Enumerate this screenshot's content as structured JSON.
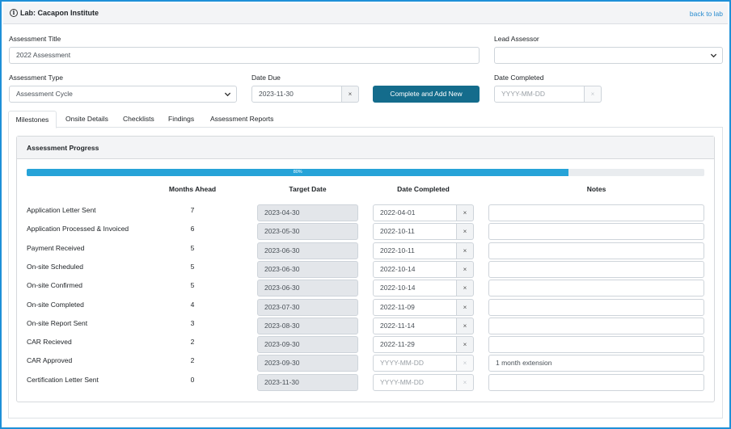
{
  "header": {
    "title": "Lab: Cacapon Institute",
    "back_link": "back to lab",
    "info_icon": "i"
  },
  "form": {
    "assessment_title_label": "Assessment Title",
    "assessment_title_value": "2022 Assessment",
    "lead_assessor_label": "Lead Assessor",
    "lead_assessor_value": "",
    "assessment_type_label": "Assessment Type",
    "assessment_type_value": "Assessment Cycle",
    "date_due_label": "Date Due",
    "date_due_value": "2023-11-30",
    "complete_button": "Complete and Add New",
    "date_completed_label": "Date Completed",
    "date_completed_placeholder": "YYYY-MM-DD",
    "clear_symbol": "×"
  },
  "tabs": [
    "Milestones",
    "Onsite Details",
    "Checklists",
    "Findings",
    "Assessment Reports"
  ],
  "active_tab": "Milestones",
  "progress": {
    "title": "Assessment Progress",
    "percent": 80,
    "label": "80%"
  },
  "table": {
    "headers": {
      "months": "Months Ahead",
      "target": "Target Date",
      "completed": "Date Completed",
      "notes": "Notes"
    },
    "rows": [
      {
        "label": "Application Letter Sent",
        "months": "7",
        "target": "2023-04-30",
        "completed": "2022-04-01",
        "notes": ""
      },
      {
        "label": "Application Processed & Invoiced",
        "months": "6",
        "target": "2023-05-30",
        "completed": "2022-10-11",
        "notes": ""
      },
      {
        "label": "Payment Received",
        "months": "5",
        "target": "2023-06-30",
        "completed": "2022-10-11",
        "notes": ""
      },
      {
        "label": "On-site Scheduled",
        "months": "5",
        "target": "2023-06-30",
        "completed": "2022-10-14",
        "notes": ""
      },
      {
        "label": "On-site Confirmed",
        "months": "5",
        "target": "2023-06-30",
        "completed": "2022-10-14",
        "notes": ""
      },
      {
        "label": "On-site Completed",
        "months": "4",
        "target": "2023-07-30",
        "completed": "2022-11-09",
        "notes": ""
      },
      {
        "label": "On-site Report Sent",
        "months": "3",
        "target": "2023-08-30",
        "completed": "2022-11-14",
        "notes": ""
      },
      {
        "label": "CAR Recieved",
        "months": "2",
        "target": "2023-09-30",
        "completed": "2022-11-29",
        "notes": ""
      },
      {
        "label": "CAR Approved",
        "months": "2",
        "target": "2023-09-30",
        "completed": "",
        "notes": "1 month extension"
      },
      {
        "label": "Certification Letter Sent",
        "months": "0",
        "target": "2023-11-30",
        "completed": "",
        "notes": ""
      }
    ],
    "completed_placeholder": "YYYY-MM-DD"
  },
  "icons": {
    "info": "info-circle-icon",
    "chevron": "chevron-down-icon",
    "clear": "close-icon"
  },
  "colors": {
    "accent_border": "#1e90d8",
    "primary_button": "#146c8c",
    "progress_fill": "#26a3d8",
    "link": "#2a8ccf"
  }
}
